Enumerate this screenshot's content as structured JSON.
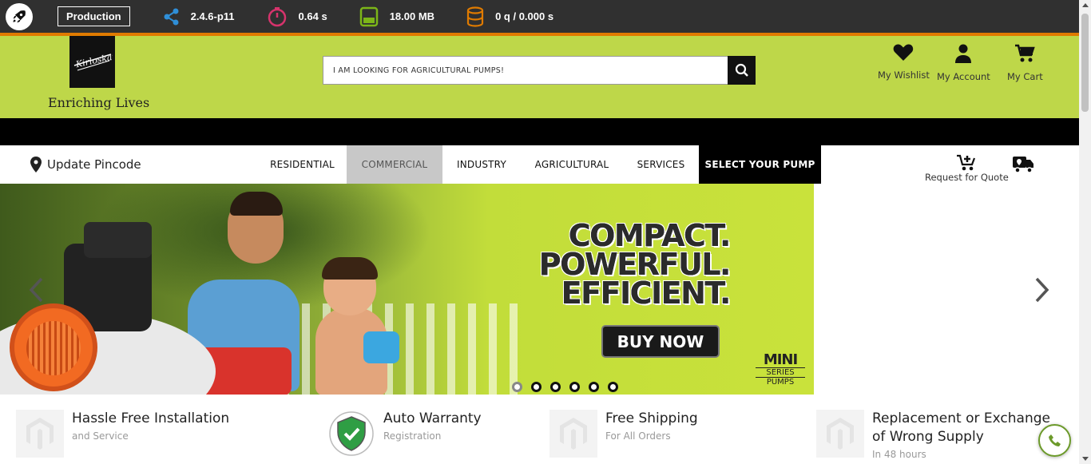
{
  "debug_toolbar": {
    "environment": "Production",
    "version": "2.4.6-p11",
    "time": "0.64 s",
    "memory": "18.00 MB",
    "queries": "0 q / 0.000 s",
    "icons": [
      "rocket-icon",
      "share-icon",
      "stopwatch-icon",
      "memory-icon",
      "database-icon"
    ]
  },
  "header": {
    "logo_text": "Kirloskar",
    "tagline": "Enriching Lives",
    "search_placeholder": "I AM LOOKING FOR AGRICULTURAL PUMPS!",
    "links": [
      {
        "label": "My Wishlist",
        "icon": "heart-icon"
      },
      {
        "label": "My Account",
        "icon": "user-icon"
      },
      {
        "label": "My Cart",
        "icon": "cart-icon"
      }
    ],
    "colors": {
      "brand": "#bed749",
      "toolbar": "#303030",
      "accent": "#e07b00"
    }
  },
  "nav": {
    "pincode_label": "Update Pincode",
    "items": [
      {
        "label": "RESIDENTIAL",
        "state": "normal"
      },
      {
        "label": "COMMERCIAL",
        "state": "active"
      },
      {
        "label": "INDUSTRY",
        "state": "normal"
      },
      {
        "label": "AGRICULTURAL",
        "state": "normal"
      },
      {
        "label": "SERVICES",
        "state": "normal"
      },
      {
        "label": "SELECT YOUR PUMP",
        "state": "highlight"
      }
    ],
    "quote_label": "Request for Quote"
  },
  "banner": {
    "headline": [
      "COMPACT.",
      "POWERFUL.",
      "EFFICIENT."
    ],
    "cta": "BUY NOW",
    "series_logo": [
      "MINI",
      "SERIES",
      "PUMPS"
    ],
    "slide_count": 6,
    "active_slide": 1
  },
  "features": [
    {
      "title": "Hassle Free Installation",
      "subtitle": "and Service",
      "icon": "magento-placeholder-icon"
    },
    {
      "title": "Auto Warranty",
      "subtitle": "Registration",
      "icon": "shield-check-icon"
    },
    {
      "title": "Free Shipping",
      "subtitle": "For All Orders",
      "icon": "magento-placeholder-icon"
    },
    {
      "title": "Replacement or Exchange of Wrong Supply",
      "subtitle": "In 48 hours",
      "icon": "magento-placeholder-icon"
    }
  ]
}
